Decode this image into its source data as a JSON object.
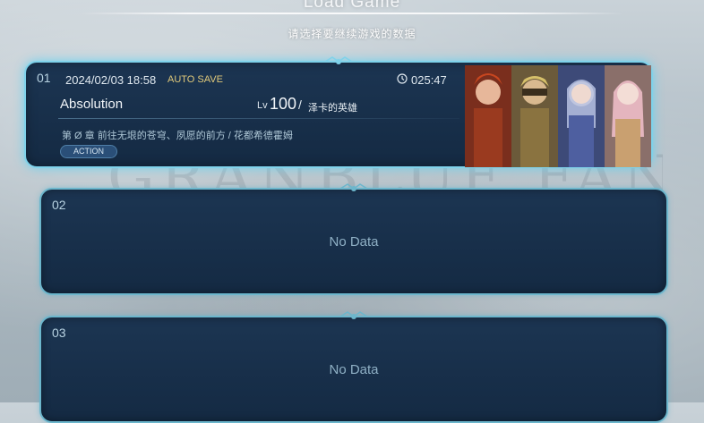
{
  "header": {
    "title": "Load Game",
    "subtitle": "请选择要继续游戏的数据"
  },
  "slots": [
    {
      "number": "01",
      "date": "2024/02/03 18:58",
      "auto_save": "AUTO SAVE",
      "playtime": "025:47",
      "name": "Absolution",
      "level_label": "Lv",
      "level": "100",
      "separator": "/",
      "title": "泽卡的英雄",
      "chapter": "第 Ø 章 前往无垠的苍穹、夙愿的前方 / 花都希德霍姆",
      "mode": "ACTION",
      "portraits": [
        "red-haired-swordsman",
        "blonde-masked-warrior",
        "silver-haired-draph-girl",
        "pink-haired-draph-woman"
      ]
    },
    {
      "number": "02",
      "status": "No Data"
    },
    {
      "number": "03",
      "status": "No Data"
    }
  ],
  "background_logo": "GRANBLUE FANTASY",
  "colors": {
    "frame": "#6cb6cc",
    "frame_active": "#7fd2ea",
    "panel": "#142a43",
    "auto_save": "#e0c97a",
    "mode_badge": "#2a4f78"
  }
}
